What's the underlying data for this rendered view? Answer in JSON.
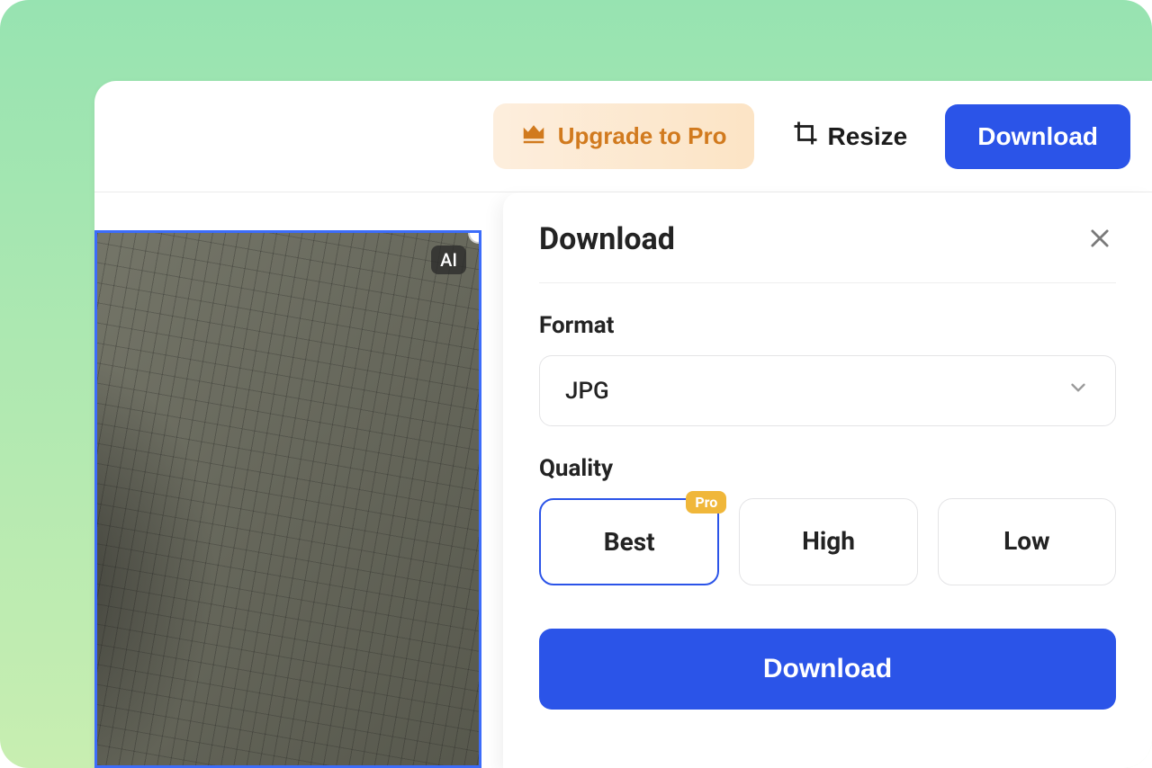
{
  "toolbar": {
    "upgrade_label": "Upgrade to Pro",
    "resize_label": "Resize",
    "download_label": "Download"
  },
  "image": {
    "ai_badge": "AI"
  },
  "panel": {
    "title": "Download",
    "format_label": "Format",
    "format_value": "JPG",
    "quality_label": "Quality",
    "quality_options": {
      "best": "Best",
      "high": "High",
      "low": "Low"
    },
    "pro_badge": "Pro",
    "download_button": "Download"
  }
}
